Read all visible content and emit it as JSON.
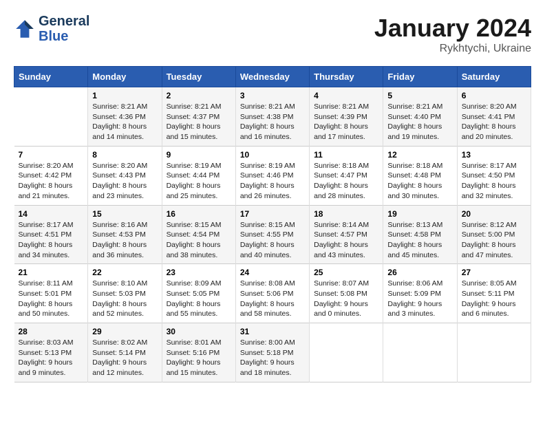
{
  "header": {
    "logo_line1": "General",
    "logo_line2": "Blue",
    "month": "January 2024",
    "location": "Rykhtychi, Ukraine"
  },
  "weekdays": [
    "Sunday",
    "Monday",
    "Tuesday",
    "Wednesday",
    "Thursday",
    "Friday",
    "Saturday"
  ],
  "weeks": [
    [
      {
        "day": "",
        "info": ""
      },
      {
        "day": "1",
        "info": "Sunrise: 8:21 AM\nSunset: 4:36 PM\nDaylight: 8 hours\nand 14 minutes."
      },
      {
        "day": "2",
        "info": "Sunrise: 8:21 AM\nSunset: 4:37 PM\nDaylight: 8 hours\nand 15 minutes."
      },
      {
        "day": "3",
        "info": "Sunrise: 8:21 AM\nSunset: 4:38 PM\nDaylight: 8 hours\nand 16 minutes."
      },
      {
        "day": "4",
        "info": "Sunrise: 8:21 AM\nSunset: 4:39 PM\nDaylight: 8 hours\nand 17 minutes."
      },
      {
        "day": "5",
        "info": "Sunrise: 8:21 AM\nSunset: 4:40 PM\nDaylight: 8 hours\nand 19 minutes."
      },
      {
        "day": "6",
        "info": "Sunrise: 8:20 AM\nSunset: 4:41 PM\nDaylight: 8 hours\nand 20 minutes."
      }
    ],
    [
      {
        "day": "7",
        "info": "Sunrise: 8:20 AM\nSunset: 4:42 PM\nDaylight: 8 hours\nand 21 minutes."
      },
      {
        "day": "8",
        "info": "Sunrise: 8:20 AM\nSunset: 4:43 PM\nDaylight: 8 hours\nand 23 minutes."
      },
      {
        "day": "9",
        "info": "Sunrise: 8:19 AM\nSunset: 4:44 PM\nDaylight: 8 hours\nand 25 minutes."
      },
      {
        "day": "10",
        "info": "Sunrise: 8:19 AM\nSunset: 4:46 PM\nDaylight: 8 hours\nand 26 minutes."
      },
      {
        "day": "11",
        "info": "Sunrise: 8:18 AM\nSunset: 4:47 PM\nDaylight: 8 hours\nand 28 minutes."
      },
      {
        "day": "12",
        "info": "Sunrise: 8:18 AM\nSunset: 4:48 PM\nDaylight: 8 hours\nand 30 minutes."
      },
      {
        "day": "13",
        "info": "Sunrise: 8:17 AM\nSunset: 4:50 PM\nDaylight: 8 hours\nand 32 minutes."
      }
    ],
    [
      {
        "day": "14",
        "info": "Sunrise: 8:17 AM\nSunset: 4:51 PM\nDaylight: 8 hours\nand 34 minutes."
      },
      {
        "day": "15",
        "info": "Sunrise: 8:16 AM\nSunset: 4:53 PM\nDaylight: 8 hours\nand 36 minutes."
      },
      {
        "day": "16",
        "info": "Sunrise: 8:15 AM\nSunset: 4:54 PM\nDaylight: 8 hours\nand 38 minutes."
      },
      {
        "day": "17",
        "info": "Sunrise: 8:15 AM\nSunset: 4:55 PM\nDaylight: 8 hours\nand 40 minutes."
      },
      {
        "day": "18",
        "info": "Sunrise: 8:14 AM\nSunset: 4:57 PM\nDaylight: 8 hours\nand 43 minutes."
      },
      {
        "day": "19",
        "info": "Sunrise: 8:13 AM\nSunset: 4:58 PM\nDaylight: 8 hours\nand 45 minutes."
      },
      {
        "day": "20",
        "info": "Sunrise: 8:12 AM\nSunset: 5:00 PM\nDaylight: 8 hours\nand 47 minutes."
      }
    ],
    [
      {
        "day": "21",
        "info": "Sunrise: 8:11 AM\nSunset: 5:01 PM\nDaylight: 8 hours\nand 50 minutes."
      },
      {
        "day": "22",
        "info": "Sunrise: 8:10 AM\nSunset: 5:03 PM\nDaylight: 8 hours\nand 52 minutes."
      },
      {
        "day": "23",
        "info": "Sunrise: 8:09 AM\nSunset: 5:05 PM\nDaylight: 8 hours\nand 55 minutes."
      },
      {
        "day": "24",
        "info": "Sunrise: 8:08 AM\nSunset: 5:06 PM\nDaylight: 8 hours\nand 58 minutes."
      },
      {
        "day": "25",
        "info": "Sunrise: 8:07 AM\nSunset: 5:08 PM\nDaylight: 9 hours\nand 0 minutes."
      },
      {
        "day": "26",
        "info": "Sunrise: 8:06 AM\nSunset: 5:09 PM\nDaylight: 9 hours\nand 3 minutes."
      },
      {
        "day": "27",
        "info": "Sunrise: 8:05 AM\nSunset: 5:11 PM\nDaylight: 9 hours\nand 6 minutes."
      }
    ],
    [
      {
        "day": "28",
        "info": "Sunrise: 8:03 AM\nSunset: 5:13 PM\nDaylight: 9 hours\nand 9 minutes."
      },
      {
        "day": "29",
        "info": "Sunrise: 8:02 AM\nSunset: 5:14 PM\nDaylight: 9 hours\nand 12 minutes."
      },
      {
        "day": "30",
        "info": "Sunrise: 8:01 AM\nSunset: 5:16 PM\nDaylight: 9 hours\nand 15 minutes."
      },
      {
        "day": "31",
        "info": "Sunrise: 8:00 AM\nSunset: 5:18 PM\nDaylight: 9 hours\nand 18 minutes."
      },
      {
        "day": "",
        "info": ""
      },
      {
        "day": "",
        "info": ""
      },
      {
        "day": "",
        "info": ""
      }
    ]
  ]
}
